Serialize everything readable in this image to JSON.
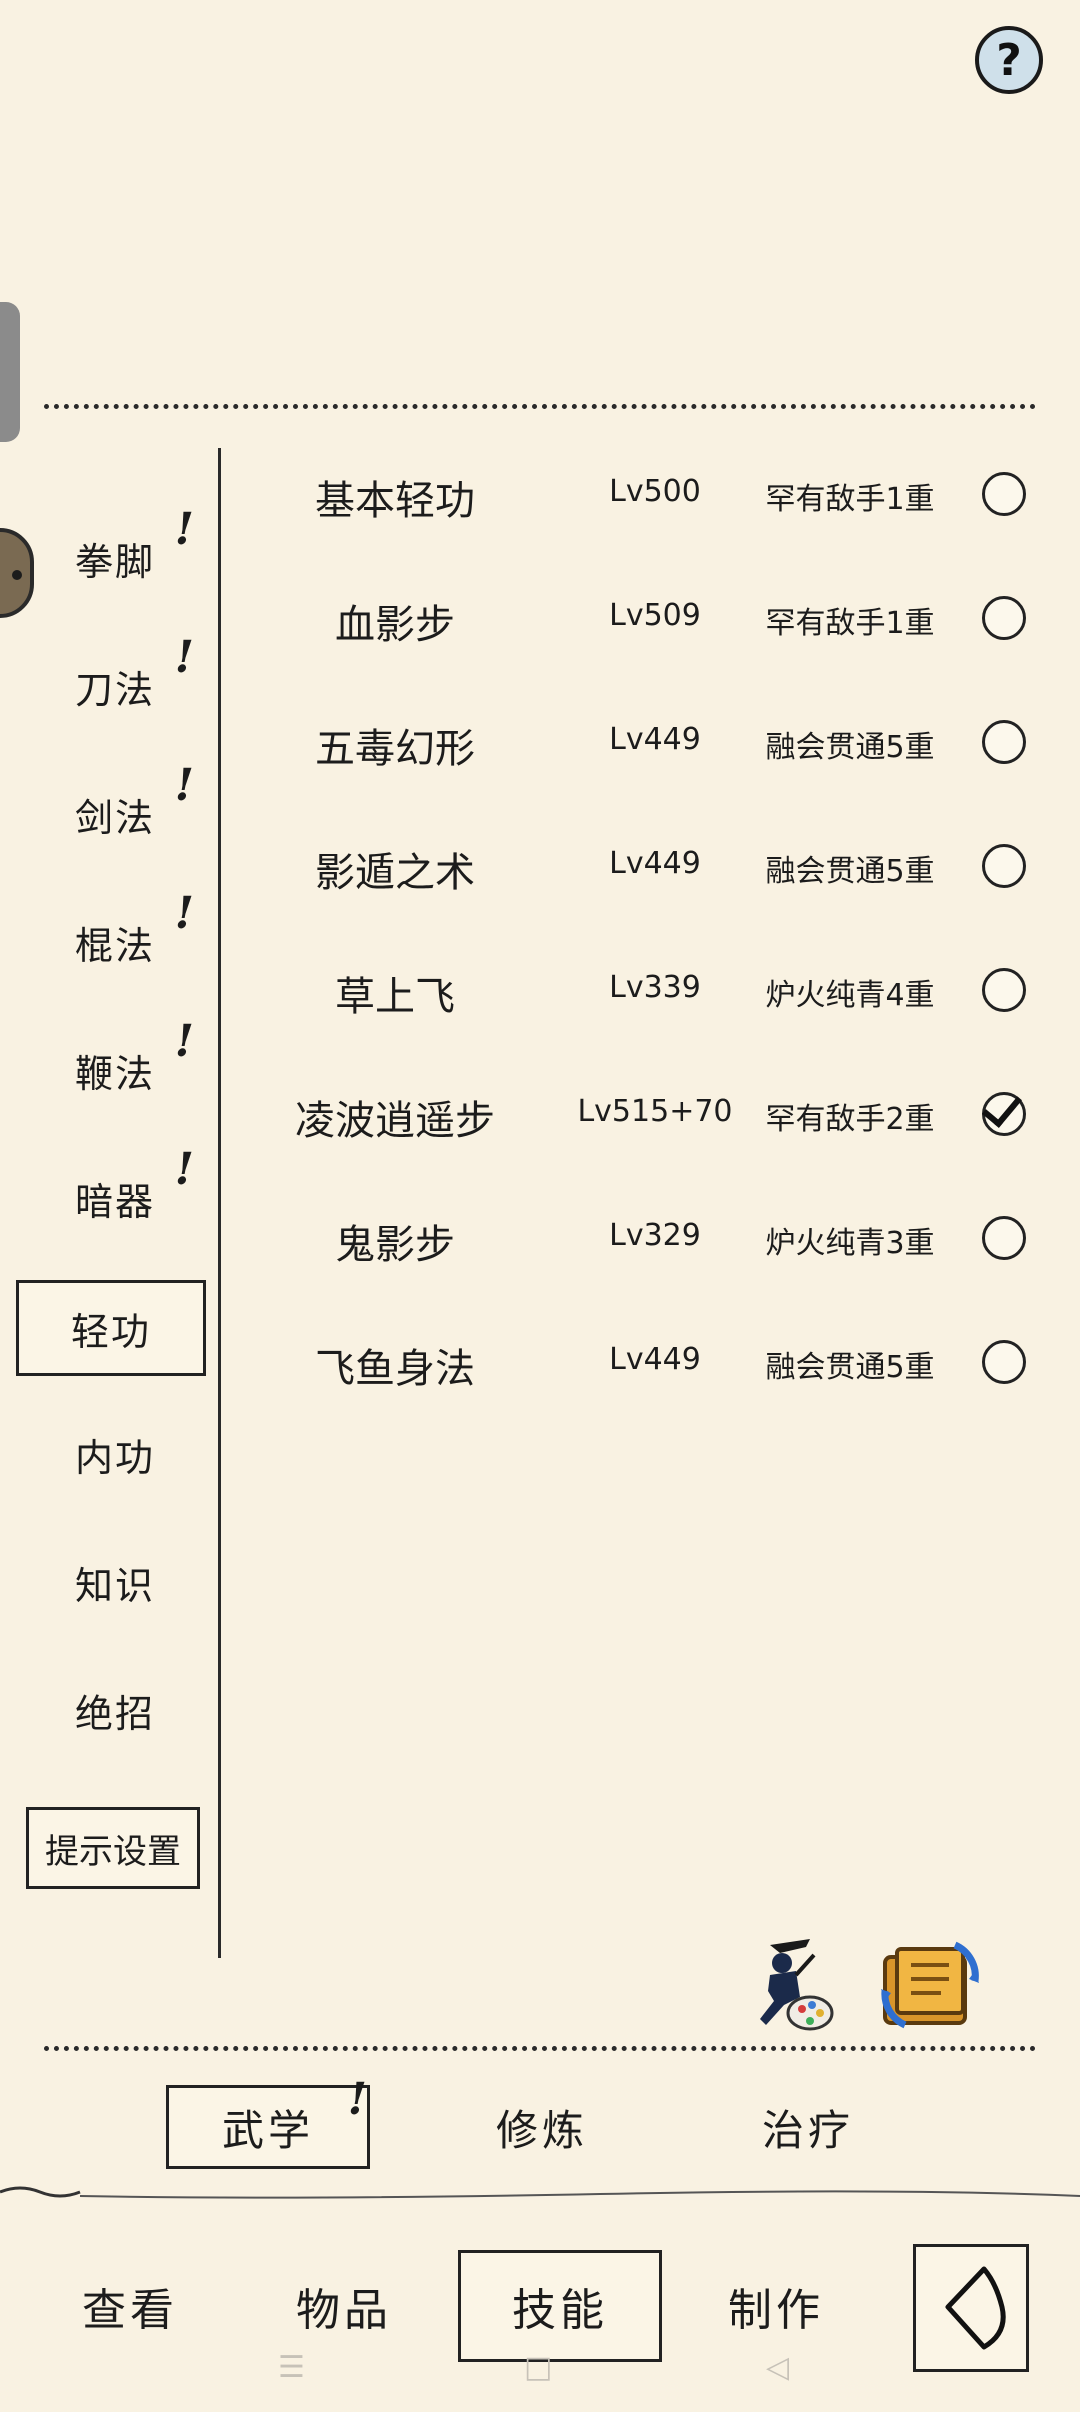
{
  "help": {
    "label": "?"
  },
  "sidebar": {
    "items": [
      {
        "label": "拳脚",
        "alert": "!"
      },
      {
        "label": "刀法",
        "alert": "!"
      },
      {
        "label": "剑法",
        "alert": "!"
      },
      {
        "label": "棍法",
        "alert": "!"
      },
      {
        "label": "鞭法",
        "alert": "!"
      },
      {
        "label": "暗器",
        "alert": "!"
      },
      {
        "label": "轻功",
        "alert": ""
      },
      {
        "label": "内功",
        "alert": ""
      },
      {
        "label": "知识",
        "alert": ""
      },
      {
        "label": "绝招",
        "alert": ""
      }
    ],
    "selected": "轻功",
    "hint_button": "提示设置"
  },
  "skills": [
    {
      "name": "基本轻功",
      "level": "Lv500",
      "rank": "罕有敌手1重",
      "checked": false
    },
    {
      "name": "血影步",
      "level": "Lv509",
      "rank": "罕有敌手1重",
      "checked": false
    },
    {
      "name": "五毒幻形",
      "level": "Lv449",
      "rank": "融会贯通5重",
      "checked": false
    },
    {
      "name": "影遁之术",
      "level": "Lv449",
      "rank": "融会贯通5重",
      "checked": false
    },
    {
      "name": "草上飞",
      "level": "Lv339",
      "rank": "炉火纯青4重",
      "checked": false
    },
    {
      "name": "凌波逍遥步",
      "level": "Lv515+70",
      "rank": "罕有敌手2重",
      "checked": true
    },
    {
      "name": "鬼影步",
      "level": "Lv329",
      "rank": "炉火纯青3重",
      "checked": false
    },
    {
      "name": "飞鱼身法",
      "level": "Lv449",
      "rank": "融会贯通5重",
      "checked": false
    }
  ],
  "tool_icons": [
    "ninja-palette-icon",
    "book-exchange-icon"
  ],
  "subtabs": {
    "items": [
      {
        "label": "武学",
        "alert": "!"
      },
      {
        "label": "修炼"
      },
      {
        "label": "治疗"
      }
    ],
    "selected": "武学"
  },
  "nav": {
    "items": [
      "查看",
      "物品",
      "技能",
      "制作"
    ],
    "selected": "技能",
    "back_icon": "back-arrow-icon"
  },
  "system_nav": {
    "menu": "☰",
    "home": "□",
    "back": "◁"
  },
  "colors": {
    "background": "#f9f2e2",
    "ink": "#1c1c1c",
    "help_fill": "#cfe0ea"
  }
}
